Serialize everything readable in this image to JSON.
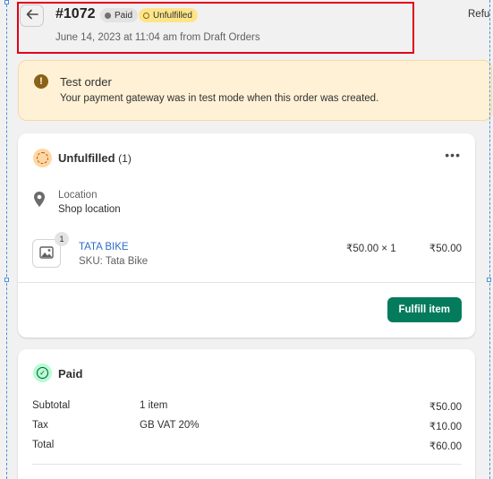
{
  "header": {
    "order_number": "#1072",
    "badge_paid": "Paid",
    "badge_unfulfilled": "Unfulfilled",
    "date_line": "June 14, 2023 at 11:04 am from Draft Orders",
    "refund_label": "Refu",
    "back_icon": "arrow-left-icon"
  },
  "banner": {
    "title": "Test order",
    "text": "Your payment gateway was in test mode when this order was created.",
    "icon": "!"
  },
  "fulfillment": {
    "title": "Unfulfilled",
    "count": "(1)",
    "more_icon": "•••",
    "location_label": "Location",
    "location_value": "Shop location",
    "item": {
      "quantity_badge": "1",
      "name": "TATA BIKE",
      "sku": "SKU: Tata Bike",
      "unit_price": "₹50.00 × 1",
      "total": "₹50.00"
    },
    "fulfill_button": "Fulfill item"
  },
  "payment": {
    "title": "Paid",
    "check_icon": "✓",
    "rows": [
      {
        "label": "Subtotal",
        "detail": "1 item",
        "amount": "₹50.00"
      },
      {
        "label": "Tax",
        "detail": "GB VAT 20%",
        "amount": "₹10.00"
      },
      {
        "label": "Total",
        "detail": "",
        "amount": "₹60.00"
      }
    ]
  },
  "colors": {
    "primary_button": "#047b5d",
    "badge_unfulfilled_bg": "#ffe58a",
    "banner_bg": "#fff1d6",
    "highlight_box": "#e0001b",
    "link": "#2c6ecb"
  }
}
